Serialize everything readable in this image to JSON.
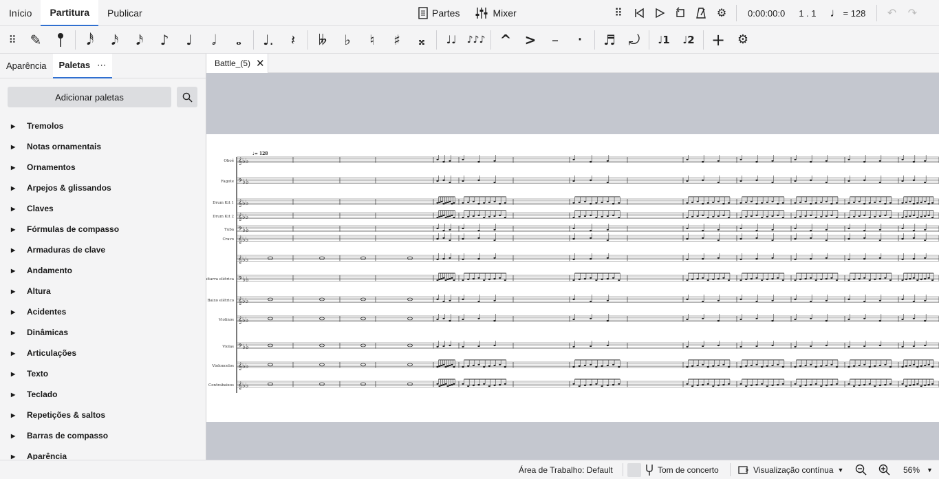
{
  "top_tabs": [
    {
      "label": "Início",
      "active": false
    },
    {
      "label": "Partitura",
      "active": true
    },
    {
      "label": "Publicar",
      "active": false
    }
  ],
  "top_center": {
    "parts_label": "Partes",
    "mixer_label": "Mixer"
  },
  "playback": {
    "time": "0:00:00:0",
    "position": "1 . 1",
    "tempo": "= 128",
    "tempo_note": "♩"
  },
  "toolbar_glyphs": {
    "pencil": "✎",
    "ballpoint": "✐",
    "n64": "𝅘𝅥𝅰",
    "n32": "𝅘𝅥𝅯",
    "n16": "𝅘𝅥𝅯",
    "n8": "♪",
    "n4": "♩",
    "n2": "𝅗𝅥",
    "n1": "𝅝",
    "dot": "♩.",
    "rest": "𝄽",
    "dflat": "𝄫",
    "flat": "♭",
    "natural": "♮",
    "sharp": "♯",
    "dsharp": "𝄪",
    "tie": "♩♩",
    "slur": "♪♪♪",
    "marcato": "^",
    "accent": ">",
    "tenuto": "–",
    "staccato": "·",
    "tuplet": "♬",
    "flip": "⤾",
    "voice1": "♩1",
    "voice2": "♩2",
    "add": "+"
  },
  "left_panel": {
    "tabs": [
      "Aparência",
      "Paletas"
    ],
    "more": "⋯",
    "add_palettes": "Adicionar paletas",
    "palettes": [
      "Tremolos",
      "Notas ornamentais",
      "Ornamentos",
      "Arpejos & glissandos",
      "Claves",
      "Fórmulas de compasso",
      "Armaduras de clave",
      "Andamento",
      "Altura",
      "Acidentes",
      "Dinâmicas",
      "Articulações",
      "Texto",
      "Teclado",
      "Repetições & saltos",
      "Barras de compasso",
      "Aparência"
    ]
  },
  "document_tab": {
    "title": "Battle_(5)"
  },
  "score": {
    "tempo_marking": "♩= 128",
    "instruments": [
      "Oboé",
      "Fagote",
      "Drum Kit 1",
      "Drum Kit 2",
      "Tuba",
      "Cravo",
      "Guitarra elétrica",
      "Baixo elétrico",
      "Violinos",
      "Violas",
      "Violoncelos",
      "Contrabaixos"
    ]
  },
  "status": {
    "workspace": "Área de Trabalho: Default",
    "concert_pitch": "Tom de concerto",
    "view_mode": "Visualização contínua",
    "zoom": "56%"
  }
}
